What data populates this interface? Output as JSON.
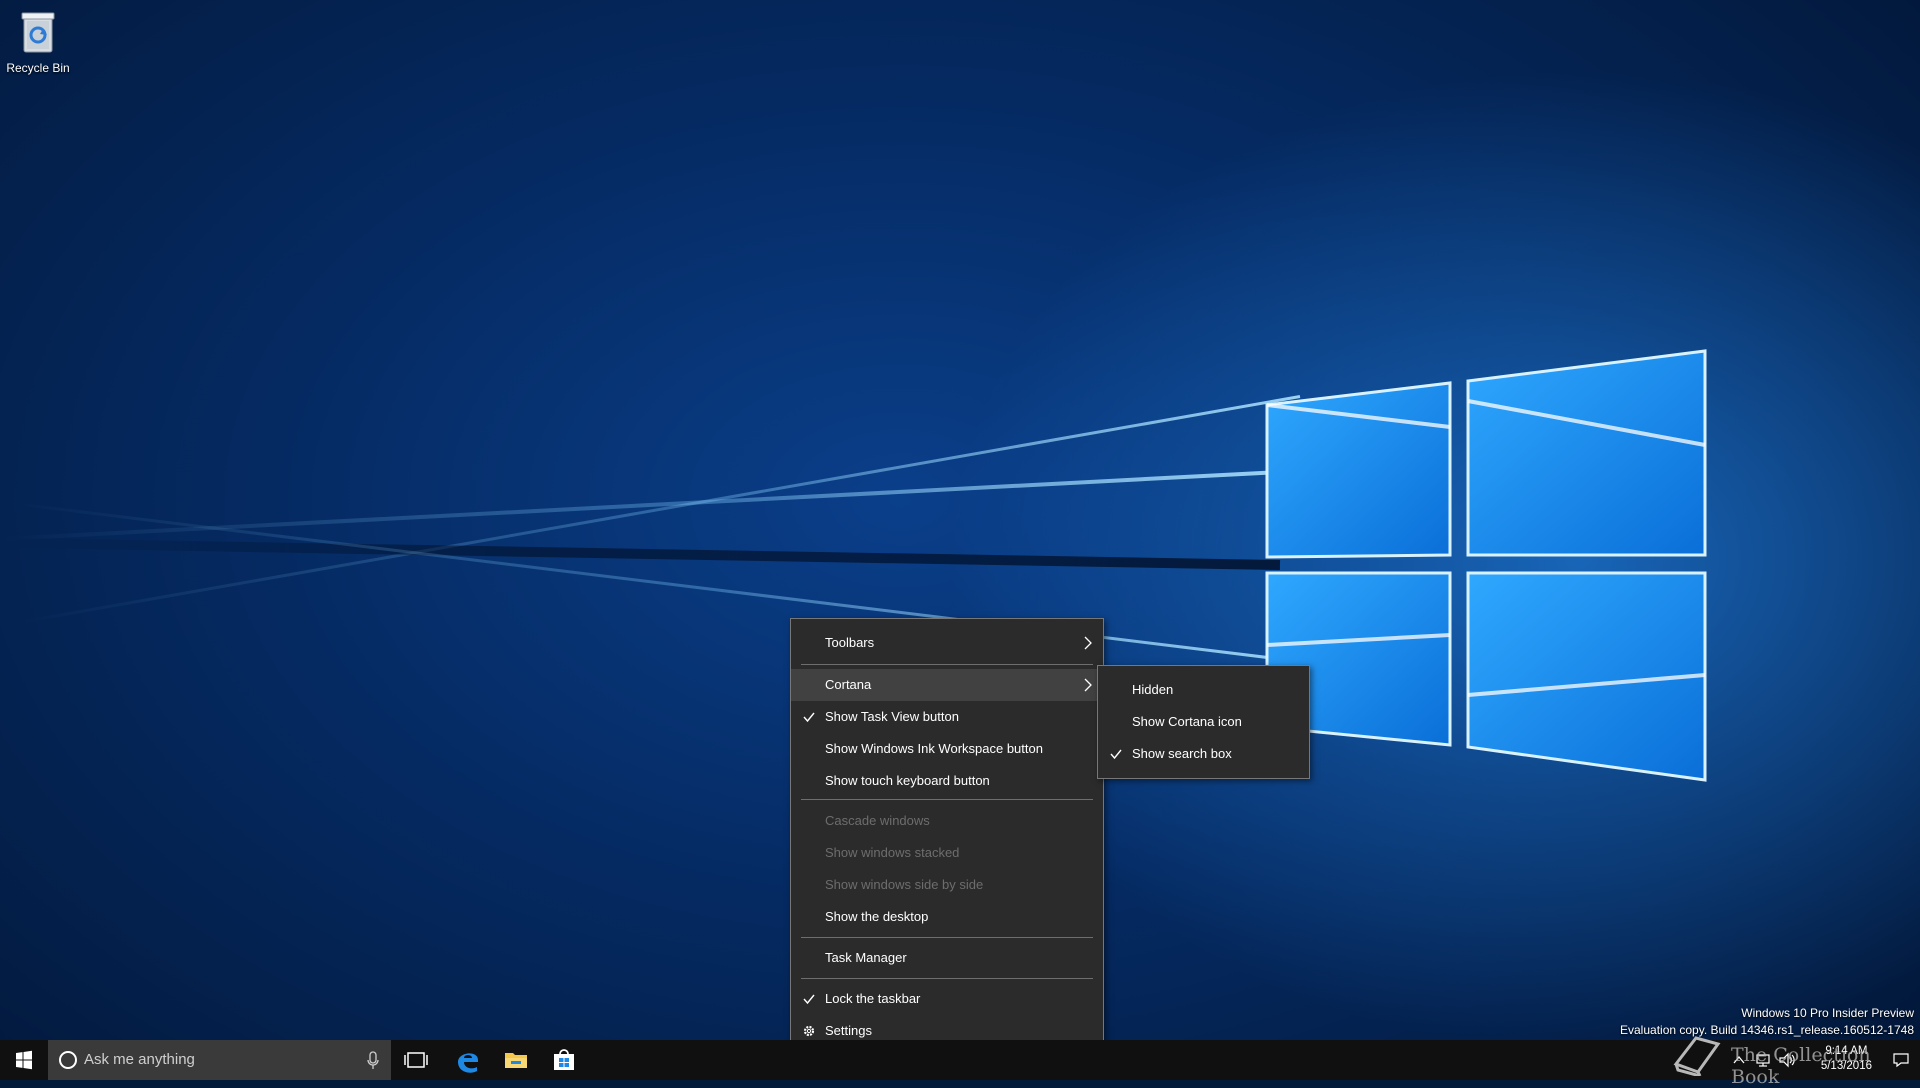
{
  "desktop": {
    "recycle_bin_label": "Recycle Bin",
    "watermark_line1": "Windows 10 Pro Insider Preview",
    "watermark_line2": "Evaluation copy. Build 14346.rs1_release.160512-1748"
  },
  "context_menu": {
    "items": [
      {
        "label": "Toolbars",
        "submenu": true
      },
      {
        "label": "Cortana",
        "submenu": true,
        "highlighted": true
      },
      {
        "label": "Show Task View button",
        "checked": true
      },
      {
        "label": "Show Windows Ink Workspace button"
      },
      {
        "label": "Show touch keyboard button"
      },
      {
        "label": "Cascade windows",
        "disabled": true
      },
      {
        "label": "Show windows stacked",
        "disabled": true
      },
      {
        "label": "Show windows side by side",
        "disabled": true
      },
      {
        "label": "Show the desktop"
      },
      {
        "label": "Task Manager"
      },
      {
        "label": "Lock the taskbar",
        "checked": true
      },
      {
        "label": "Settings",
        "icon": "gear-icon"
      }
    ]
  },
  "cortana_submenu": {
    "items": [
      {
        "label": "Hidden"
      },
      {
        "label": "Show Cortana icon"
      },
      {
        "label": "Show search box",
        "checked": true
      }
    ]
  },
  "taskbar": {
    "search_placeholder": "Ask me anything",
    "pinned": [
      "task-view-icon",
      "edge-icon",
      "file-explorer-icon",
      "store-icon"
    ],
    "clock_time": "9:14 AM",
    "clock_date": "5/13/2016"
  },
  "overlay_text": "The Collection Book",
  "colors": {
    "menu_bg": "#2b2b2b",
    "menu_highlight": "#414141",
    "taskbar_bg": "#101010",
    "search_bg": "#3a3a3a",
    "accent": "#0078d7"
  }
}
